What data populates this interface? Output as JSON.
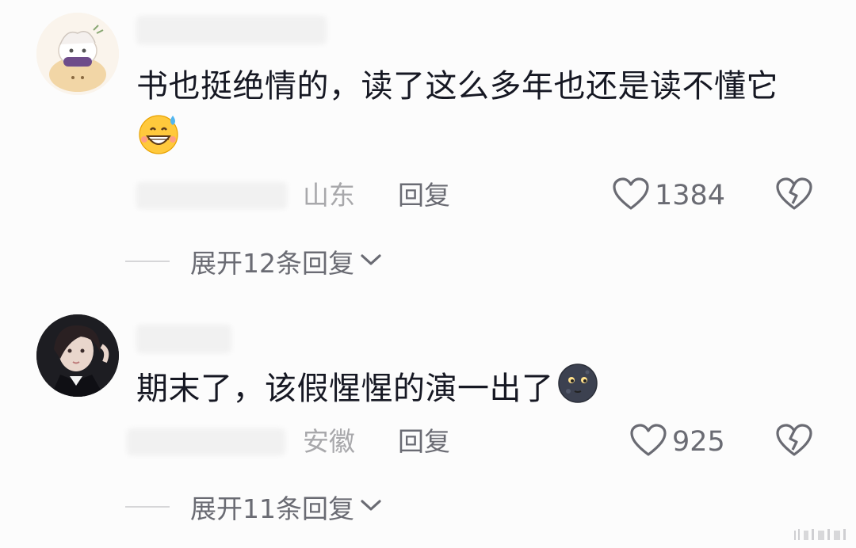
{
  "comments": [
    {
      "text": "书也挺绝情的，读了这么多年也还是读不懂它",
      "emoji": "grinning-sweat-emoji",
      "location": "山东",
      "reply_label": "回复",
      "likes": "1384",
      "expand_label": "展开12条回复"
    },
    {
      "text": "期末了，该假惺惺的演一出了",
      "emoji": "new-moon-face-emoji",
      "location": "安徽",
      "reply_label": "回复",
      "likes": "925",
      "expand_label": "展开11条回复"
    }
  ],
  "colors": {
    "background": "#fcfcfc",
    "text": "#161823",
    "secondary": "#6a6b73",
    "location": "#a8a8ab"
  },
  "icons": [
    "heart-outline-icon",
    "broken-heart-icon",
    "chevron-down-icon"
  ]
}
